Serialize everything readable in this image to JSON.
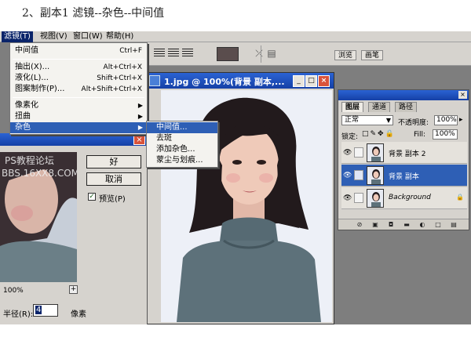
{
  "caption": "2、副本1 滤镜--杂色--中间值",
  "menubar": {
    "items": [
      {
        "label": "滤镜(T)",
        "active": true
      },
      {
        "label": "视图(V)",
        "active": false
      },
      {
        "label": "窗口(W)",
        "active": false
      },
      {
        "label": "帮助(H)",
        "active": false
      }
    ]
  },
  "filter_menu": {
    "last_filter": {
      "label": "中间值",
      "shortcut": "Ctrl+F"
    },
    "extract": {
      "label": "抽出(X)...",
      "shortcut": "Alt+Ctrl+X"
    },
    "liquify": {
      "label": "液化(L)...",
      "shortcut": "Shift+Ctrl+X"
    },
    "pattern": {
      "label": "图案制作(P)...",
      "shortcut": "Alt+Shift+Ctrl+X"
    },
    "pixelate": "像素化",
    "distort": "扭曲",
    "noise": "杂色"
  },
  "noise_submenu": {
    "items": [
      "中间值...",
      "去斑",
      "添加杂色...",
      "蒙尘与划痕..."
    ]
  },
  "toolbar": {
    "swatch_color": "#5a4d4d",
    "palette_tabs": [
      "浏览",
      "画笔"
    ]
  },
  "document": {
    "title": "1.jpg @ 100%(背景 副本,...",
    "controls": [
      "_",
      "□",
      "×"
    ]
  },
  "dialog": {
    "watermark_line1": "PS教程论坛",
    "watermark_line2": "BBS.16XX8.COM",
    "ok_label": "好",
    "cancel_label": "取消",
    "preview_checked": "✓",
    "preview_label": "预览(P)",
    "zoom": "100%",
    "zoom_plus": "+",
    "radius_label": "半径(R):",
    "radius_value": "4",
    "radius_unit": "像素",
    "close": "×"
  },
  "layers_panel": {
    "tabs": [
      "图层",
      "通道",
      "路径"
    ],
    "blend_mode": "正常",
    "opacity_label": "不透明度:",
    "opacity_value": "100%",
    "lock_label": "锁定:",
    "fill_label": "Fill:",
    "fill_value": "100%",
    "layers": [
      {
        "name": "背景 副本 2",
        "selected": false,
        "italic": false,
        "locked": false
      },
      {
        "name": "背景 副本",
        "selected": true,
        "italic": false,
        "locked": false
      },
      {
        "name": "Background",
        "selected": false,
        "italic": true,
        "locked": true
      }
    ],
    "close": "×"
  },
  "colors": {
    "titlebar": "#2b63d3",
    "highlight": "#2e5fb5",
    "workspace": "#7e7e7e",
    "chrome": "#d6d3ce"
  }
}
